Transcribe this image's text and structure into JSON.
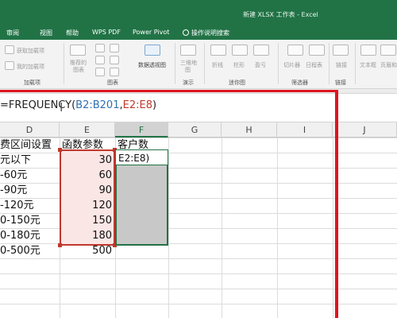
{
  "window": {
    "title": "新建 XLSX 工作表 - Excel"
  },
  "tabs": [
    "审阅",
    "视图",
    "帮助",
    "WPS PDF",
    "Power Pivot"
  ],
  "tell_me": {
    "label": "操作说明搜索",
    "icon": "lightbulb-icon"
  },
  "ribbon": {
    "items": {
      "get_addins": "获取加载项",
      "my_addins": "我的加载项",
      "recommended_charts_l1": "推荐的",
      "recommended_charts_l2": "图表",
      "pivot_chart": "数据透视图",
      "map_3d_l1": "三维地",
      "map_3d_l2": "图",
      "sparkline_line": "折线",
      "sparkline_column": "柱形",
      "sparkline_winloss": "盈亏",
      "slicer": "切片器",
      "timeline": "日程表",
      "link": "链接",
      "textbox": "文本框",
      "header_footer": "页眉和"
    },
    "groups": {
      "addins": "加载项",
      "charts": "图表",
      "tours": "演示",
      "sparklines": "迷你图",
      "filters": "筛选器",
      "links": "链接"
    }
  },
  "formula_bar": {
    "prefix": "=FREQUENCY(",
    "ref1": "B2:B201",
    "comma": ",",
    "ref2": "E2:E8",
    "suffix": ")"
  },
  "columns": [
    "D",
    "E",
    "F",
    "G",
    "H",
    "I",
    "J"
  ],
  "active_column": "F",
  "headers": {
    "d": "费区间设置",
    "e": "函数参数",
    "f": "客户数"
  },
  "rows": [
    {
      "d": "元以下",
      "e": "30"
    },
    {
      "d": "-60元",
      "e": "60"
    },
    {
      "d": "-90元",
      "e": "90"
    },
    {
      "d": "-120元",
      "e": "120"
    },
    {
      "d": "0-150元",
      "e": "150"
    },
    {
      "d": "0-180元",
      "e": "180"
    },
    {
      "d": "0-500元",
      "e": "500"
    }
  ],
  "active_cell_text": "E2:E8)",
  "colors": {
    "excel_green": "#217346",
    "ref_red": "#c0392b",
    "ref_blue": "#2f6fb2",
    "annotation_red": "#e0141e"
  }
}
